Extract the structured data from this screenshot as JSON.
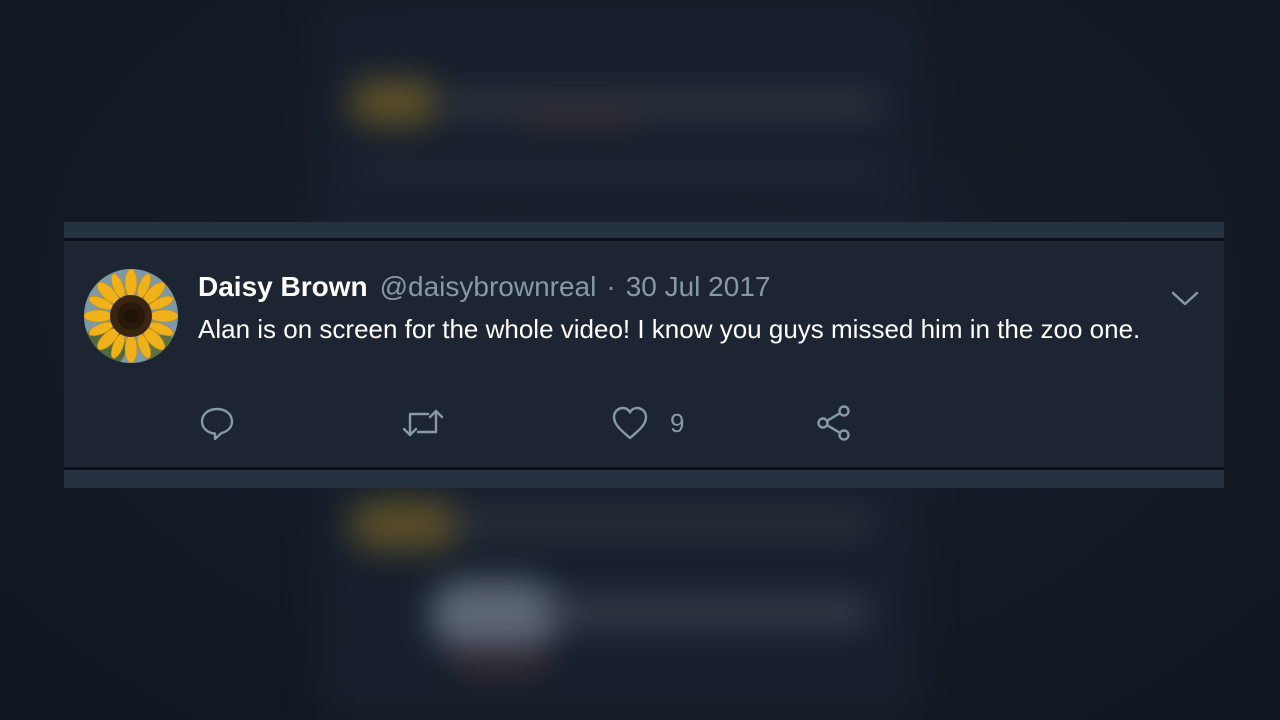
{
  "tweet": {
    "author_name": "Daisy Brown",
    "handle": "@daisybrownreal",
    "separator": "·",
    "date": "30 Jul 2017",
    "text": "Alan is on screen for the whole video! I know you guys missed him in the zoo one.",
    "likes_count": "9"
  },
  "icons": {
    "reply": "speech-bubble-icon",
    "retweet": "retweet-arrows-icon",
    "like": "heart-icon",
    "share": "share-nodes-icon",
    "menu": "chevron-down-icon",
    "avatar": "sunflower-avatar"
  },
  "colors": {
    "card_background": "#1c2531",
    "primary_text": "#ffffff",
    "secondary_text": "#8899a6"
  }
}
